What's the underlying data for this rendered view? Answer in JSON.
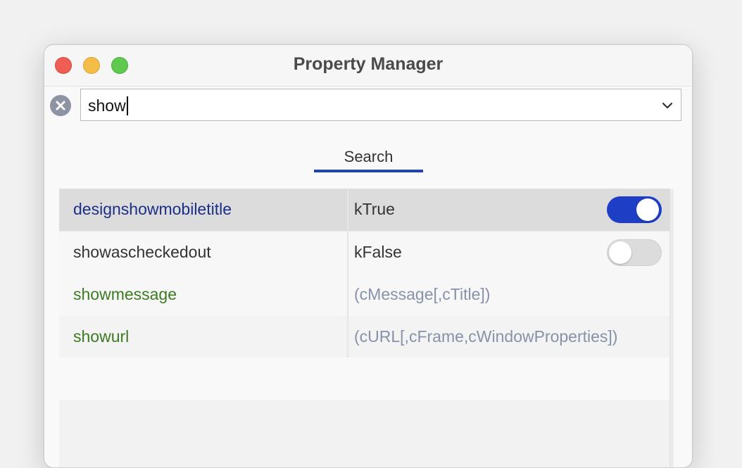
{
  "window": {
    "title": "Property Manager"
  },
  "search": {
    "value": "show"
  },
  "tabs": [
    {
      "label": "Search",
      "active": true
    }
  ],
  "rows": [
    {
      "name": "designshowmobiletitle",
      "value": "kTrue",
      "toggle": "on",
      "selected": true
    },
    {
      "name": "showascheckedout",
      "value": "kFalse",
      "toggle": "off",
      "selected": false
    },
    {
      "name": "showmessage",
      "value": "(cMessage[,cTitle])"
    },
    {
      "name": "showurl",
      "value": "(cURL[,cFrame,cWindowProperties])"
    }
  ],
  "colors": {
    "accent": "#1f44b8",
    "toggle_on": "#1e3fc5",
    "property_name": "#1c2f86",
    "method_name": "#3b7b22",
    "hint_text": "#8792a8"
  },
  "icons": {
    "clear": "x-circle-icon",
    "dropdown": "chevron-down-icon"
  }
}
